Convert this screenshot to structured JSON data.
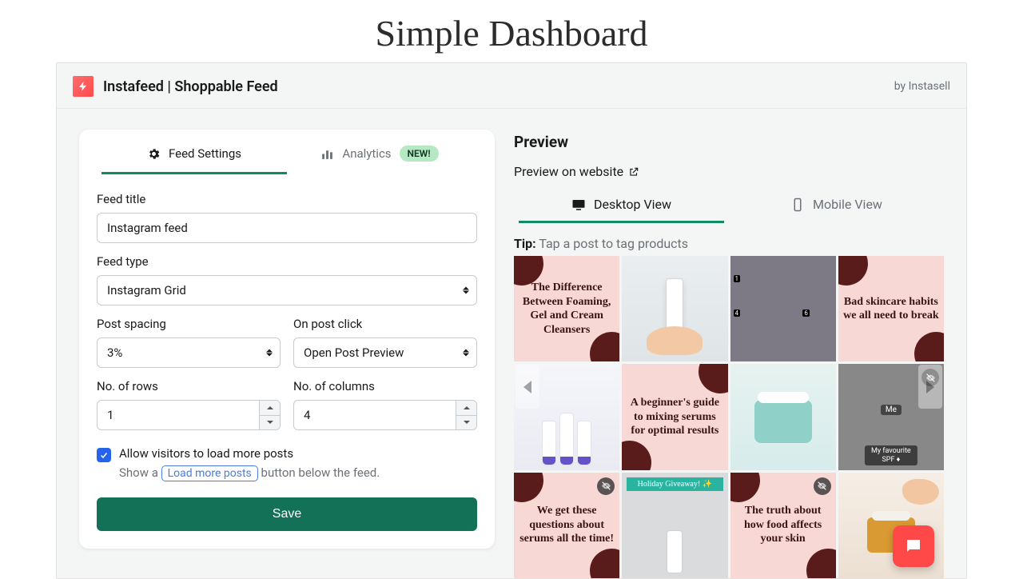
{
  "page_title": "Simple Dashboard",
  "app": {
    "name": "Instafeed | Shoppable Feed",
    "by": "by Instasell"
  },
  "tabs": {
    "settings": "Feed Settings",
    "analytics": "Analytics",
    "new_badge": "NEW!"
  },
  "form": {
    "title_label": "Feed title",
    "title_value": "Instagram feed",
    "type_label": "Feed type",
    "type_value": "Instagram Grid",
    "spacing_label": "Post spacing",
    "spacing_value": "3%",
    "click_label": "On post click",
    "click_value": "Open Post Preview",
    "rows_label": "No. of rows",
    "rows_value": "1",
    "cols_label": "No. of columns",
    "cols_value": "4",
    "checkbox_label": "Allow visitors to load more posts",
    "sub_prefix": "Show a ",
    "sub_button": "Load more posts",
    "sub_suffix": " button below the feed.",
    "save": "Save"
  },
  "preview": {
    "title": "Preview",
    "link": "Preview on website",
    "desktop": "Desktop View",
    "mobile": "Mobile View",
    "tip_label": "Tip:",
    "tip_text": "Tap a post to tag products"
  },
  "tiles": {
    "t1": "The Difference Between Foaming, Gel and Cream Cleansers",
    "t4": "Bad skincare habits we all need to break",
    "t6": "A beginner's guide to mixing serums for optimal results",
    "t8_me": "Me",
    "t8_cap": "My favourite SPF ♦",
    "t9": "We get these questions about serums all the time!",
    "t10": "Holiday Giveaway! ✨",
    "t11": "The truth about how food affects your skin"
  }
}
